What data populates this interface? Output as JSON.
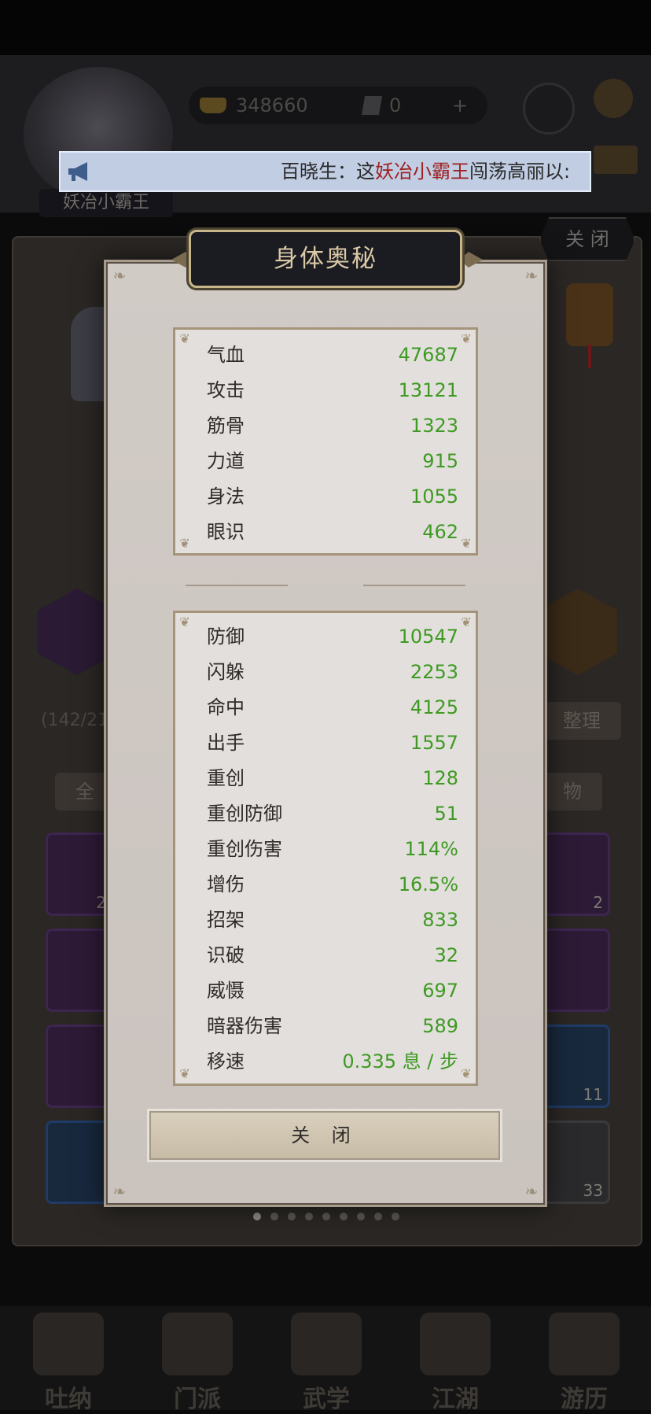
{
  "notice": {
    "prefix": "百晓生：这",
    "highlight": "妖冶小霸王",
    "suffix": "闯荡高丽以:"
  },
  "background": {
    "money_value": "348660",
    "gem_value": "0",
    "plus_label": "+",
    "player_name": "妖冶小霸王",
    "close_top_label": "关 闭",
    "count_left": "(142/21",
    "sort_label": "整理",
    "tab_all": "全",
    "tab_items": "物",
    "slot_counts": [
      "2",
      "2",
      "11",
      "33"
    ],
    "nav": [
      "吐纳",
      "门派",
      "武学",
      "江湖",
      "游历"
    ]
  },
  "popup": {
    "title": "身体奥秘",
    "close_button": "关 闭",
    "primary_stats": [
      {
        "label": "气血",
        "value": "47687"
      },
      {
        "label": "攻击",
        "value": "13121"
      },
      {
        "label": "筋骨",
        "value": "1323"
      },
      {
        "label": "力道",
        "value": "915"
      },
      {
        "label": "身法",
        "value": "1055"
      },
      {
        "label": "眼识",
        "value": "462"
      }
    ],
    "secondary_stats": [
      {
        "label": "防御",
        "value": "10547"
      },
      {
        "label": "闪躲",
        "value": "2253"
      },
      {
        "label": "命中",
        "value": "4125"
      },
      {
        "label": "出手",
        "value": "1557"
      },
      {
        "label": "重创",
        "value": "128"
      },
      {
        "label": "重创防御",
        "value": "51"
      },
      {
        "label": "重创伤害",
        "value": "114%"
      },
      {
        "label": "增伤",
        "value": "16.5%"
      },
      {
        "label": "招架",
        "value": "833"
      },
      {
        "label": "识破",
        "value": "32"
      },
      {
        "label": "威慑",
        "value": "697"
      },
      {
        "label": "暗器伤害",
        "value": "589"
      },
      {
        "label": "移速",
        "value": "0.335 息 / 步"
      }
    ]
  },
  "colors": {
    "stat_value": "#3e9a22",
    "notice_highlight": "#a02020",
    "title_text": "#d9c9a5"
  }
}
